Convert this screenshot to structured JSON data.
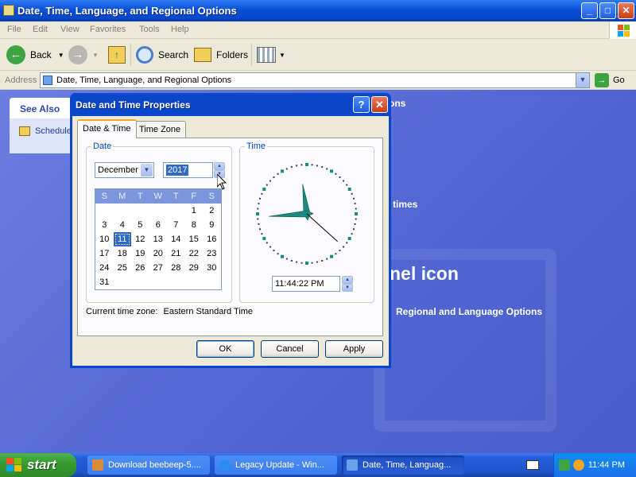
{
  "window": {
    "title": "Date, Time, Language, and Regional Options",
    "minimize": "_",
    "maximize": "□",
    "close": "✕"
  },
  "menu": [
    "File",
    "Edit",
    "View",
    "Favorites",
    "Tools",
    "Help"
  ],
  "toolbar": {
    "back_label": "Back",
    "search_label": "Search",
    "folders_label": "Folders"
  },
  "address": {
    "label": "Address",
    "value": "Date, Time, Language, and Regional Options",
    "go_label": "Go"
  },
  "see_also": {
    "header": "See Also",
    "item": "Schedule"
  },
  "background_text": {
    "fragment_1": "ons",
    "fragment_2": "times",
    "fragment_3": "nel icon",
    "fragment_4": "Regional and Language Options"
  },
  "dialog": {
    "title": "Date and Time Properties",
    "help_btn": "?",
    "close_btn": "✕",
    "tabs": [
      "Date & Time",
      "Time Zone"
    ],
    "date_group_label": "Date",
    "time_group_label": "Time",
    "month": "December",
    "year": "2017",
    "weekdays": [
      "S",
      "M",
      "T",
      "W",
      "T",
      "F",
      "S"
    ],
    "calendar_days": [
      "",
      "",
      "",
      "",
      "",
      "1",
      "2",
      "3",
      "4",
      "5",
      "6",
      "7",
      "8",
      "9",
      "10",
      "11",
      "12",
      "13",
      "14",
      "15",
      "16",
      "17",
      "18",
      "19",
      "20",
      "21",
      "22",
      "23",
      "24",
      "25",
      "26",
      "27",
      "28",
      "29",
      "30",
      "31"
    ],
    "selected_day": "11",
    "time_value": "11:44:22 PM",
    "time_zone_label": "Current time zone:",
    "time_zone_value": "Eastern Standard Time",
    "ok_label": "OK",
    "cancel_label": "Cancel",
    "apply_label": "Apply"
  },
  "clock_hands": {
    "hour": 11,
    "minute": 44,
    "second": 22
  },
  "taskbar": {
    "start_label": "start",
    "tasks": [
      "Download beebeep-5....",
      "Legacy Update - Win...",
      "Date, Time, Languag..."
    ],
    "clock": "11:44 PM"
  },
  "colors": {
    "title_blue": "#0a4fd6",
    "content_blue": "#5165d2",
    "selection_blue": "#316ac5",
    "clock_green": "#1a8a82",
    "start_green": "#35982f"
  }
}
